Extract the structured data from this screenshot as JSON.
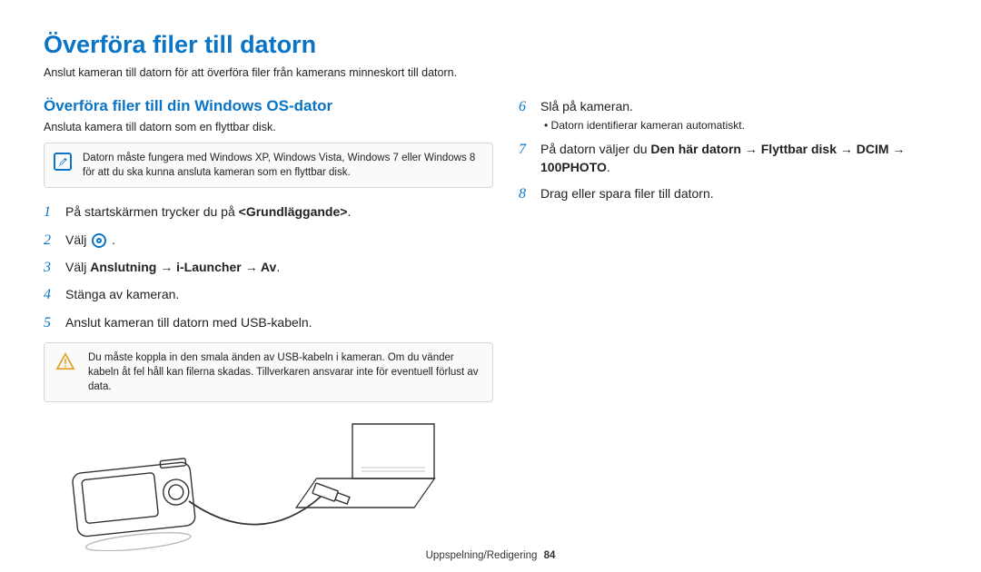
{
  "page": {
    "title": "Överföra filer till datorn",
    "intro": "Anslut kameran till datorn för att överföra filer från kamerans minneskort till datorn."
  },
  "left": {
    "subhead": "Överföra filer till din Windows OS-dator",
    "sub_intro": "Ansluta kamera till datorn som en flyttbar disk.",
    "note": "Datorn måste fungera med Windows XP, Windows Vista, Windows 7 eller Windows 8 för att du ska kunna ansluta kameran som en flyttbar disk.",
    "steps": {
      "1": {
        "num": "1",
        "pre": "På startskärmen trycker du på ",
        "bold": "<Grundläggande>",
        "post": "."
      },
      "2": {
        "num": "2",
        "pre": "Välj ",
        "post": " ."
      },
      "3": {
        "num": "3",
        "pre": "Välj ",
        "bold": "Anslutning → i-Launcher → Av",
        "post": "."
      },
      "4": {
        "num": "4",
        "text": "Stänga av kameran."
      },
      "5": {
        "num": "5",
        "text": "Anslut kameran till datorn med USB-kabeln."
      }
    },
    "warn": "Du måste koppla in den smala änden av USB-kabeln i kameran. Om du vänder kabeln åt fel håll kan filerna skadas. Tillverkaren ansvarar inte för eventuell förlust av data."
  },
  "right": {
    "steps": {
      "6": {
        "num": "6",
        "text": "Slå på kameran.",
        "sub": "Datorn identifierar kameran automatiskt."
      },
      "7": {
        "num": "7",
        "pre": "På datorn väljer du ",
        "bold": "Den här datorn → Flyttbar disk → DCIM → 100PHOTO",
        "post": "."
      },
      "8": {
        "num": "8",
        "text": "Drag eller spara filer till datorn."
      }
    }
  },
  "footer": {
    "section": "Uppspelning/Redigering",
    "page": "84"
  },
  "icons": {
    "note": "note-icon",
    "warn": "warning-icon",
    "settings": "settings-gear-icon"
  }
}
